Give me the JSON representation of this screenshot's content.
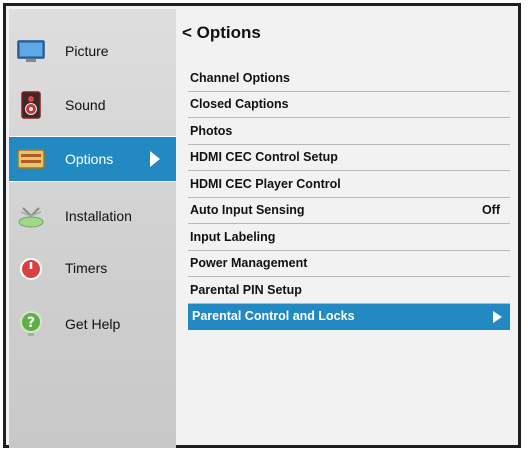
{
  "sidebar": {
    "items": [
      {
        "label": "Picture",
        "icon": "tv-icon"
      },
      {
        "label": "Sound",
        "icon": "speaker-icon"
      },
      {
        "label": "Options",
        "icon": "options-icon",
        "active": true
      },
      {
        "label": "Installation",
        "icon": "antenna-icon"
      },
      {
        "label": "Timers",
        "icon": "timer-icon"
      },
      {
        "label": "Get Help",
        "icon": "help-icon"
      }
    ]
  },
  "main": {
    "title": "< Options",
    "menu": [
      {
        "label": "Channel Options"
      },
      {
        "label": "Closed Captions"
      },
      {
        "label": "Photos"
      },
      {
        "label": "HDMI CEC Control Setup"
      },
      {
        "label": "HDMI CEC Player Control"
      },
      {
        "label": "Auto Input Sensing",
        "value": "Off"
      },
      {
        "label": "Input Labeling"
      },
      {
        "label": "Power Management"
      },
      {
        "label": "Parental PIN Setup"
      },
      {
        "label": "Parental Control and Locks",
        "selected": true
      }
    ]
  },
  "colors": {
    "accent": "#2289c2",
    "sidebar_bg": "#d4d4d4",
    "main_bg": "#f2f2f2"
  }
}
